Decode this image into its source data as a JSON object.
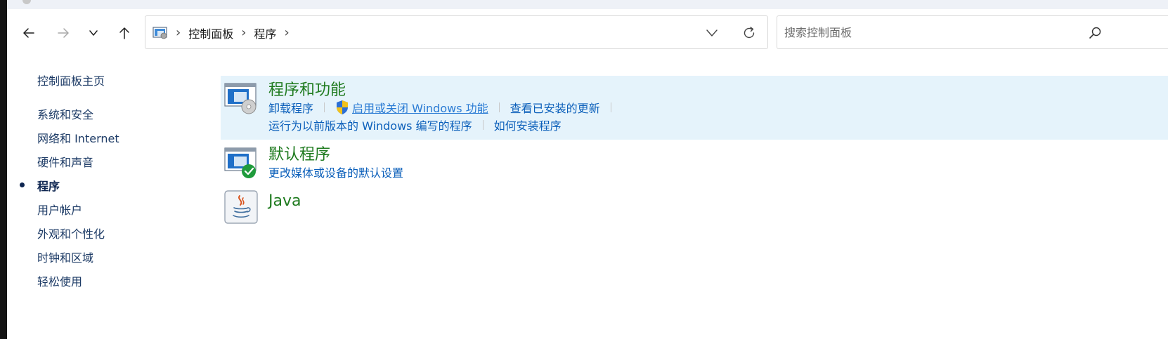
{
  "nav": {
    "back_icon": "arrow-left-icon",
    "forward_icon": "arrow-right-icon",
    "recent_icon": "chevron-down-icon",
    "up_icon": "arrow-up-icon"
  },
  "address": {
    "location_icon": "control-panel-icon",
    "crumbs": [
      "控制面板",
      "程序"
    ],
    "separator": "›"
  },
  "search": {
    "placeholder": "搜索控制面板",
    "value": ""
  },
  "sidebar": {
    "home": "控制面板主页",
    "items": [
      {
        "label": "系统和安全",
        "active": false
      },
      {
        "label": "网络和 Internet",
        "active": false
      },
      {
        "label": "硬件和声音",
        "active": false
      },
      {
        "label": "程序",
        "active": true
      },
      {
        "label": "用户帐户",
        "active": false
      },
      {
        "label": "外观和个性化",
        "active": false
      },
      {
        "label": "时钟和区域",
        "active": false
      },
      {
        "label": "轻松使用",
        "active": false
      }
    ]
  },
  "categories": [
    {
      "title": "程序和功能",
      "icon": "programs-and-features-icon",
      "highlighted": true,
      "links_row1": [
        "卸载程序",
        "启用或关闭 Windows 功能",
        "查看已安装的更新"
      ],
      "links_row2": [
        "运行为以前版本的 Windows 编写的程序",
        "如何安装程序"
      ]
    },
    {
      "title": "默认程序",
      "icon": "default-programs-icon",
      "highlighted": false,
      "links_row1": [
        "更改媒体或设备的默认设置"
      ]
    },
    {
      "title": "Java",
      "icon": "java-icon",
      "highlighted": false
    }
  ],
  "colors": {
    "category_title": "#1e7a1e",
    "link": "#0b5fba",
    "highlight_bg": "#e5f3fb",
    "sidebar_text": "#1d3b66"
  }
}
